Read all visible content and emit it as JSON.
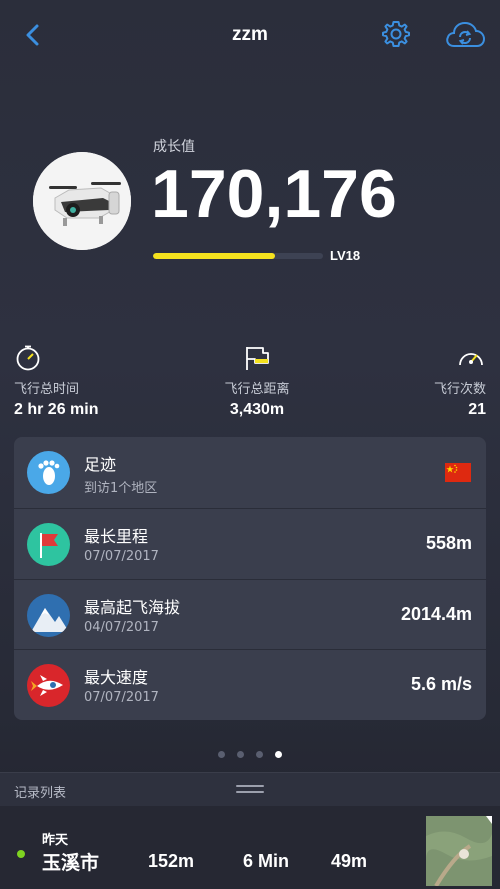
{
  "header": {
    "title": "zzm",
    "accent": "#3b8fe0"
  },
  "growth": {
    "label": "成长值",
    "value": "170,176",
    "level": "LV18",
    "level_progress": 0.72,
    "bar_color": "#f5e21e"
  },
  "stats": [
    {
      "label": "飞行总时间",
      "value": "2 hr 26 min",
      "icon": "stopwatch-icon"
    },
    {
      "label": "飞行总距离",
      "value": "3,430m",
      "icon": "flag-icon"
    },
    {
      "label": "飞行次数",
      "value": "21",
      "icon": "speedometer-icon"
    }
  ],
  "achievements": [
    {
      "title": "足迹",
      "sub": "到访1个地区",
      "value": "",
      "icon": "footprint-icon",
      "icon_color": "#4aa8e8"
    },
    {
      "title": "最长里程",
      "sub": "07/07/2017",
      "value": "558m",
      "icon": "red-flag-icon",
      "icon_color": "#2ec4a0"
    },
    {
      "title": "最高起飞海拔",
      "sub": "04/07/2017",
      "value": "2014.4m",
      "icon": "mountain-icon",
      "icon_color": "#2f6fb0"
    },
    {
      "title": "最大速度",
      "sub": "07/07/2017",
      "value": "5.6 m/s",
      "icon": "rocket-icon",
      "icon_color": "#d9262b"
    }
  ],
  "pager": {
    "count": 4,
    "active": 4
  },
  "records": {
    "label": "记录列表",
    "item": {
      "day": "昨天",
      "place": "玉溪市",
      "distance": "152m",
      "duration": "6 Min",
      "altitude": "49m"
    }
  }
}
